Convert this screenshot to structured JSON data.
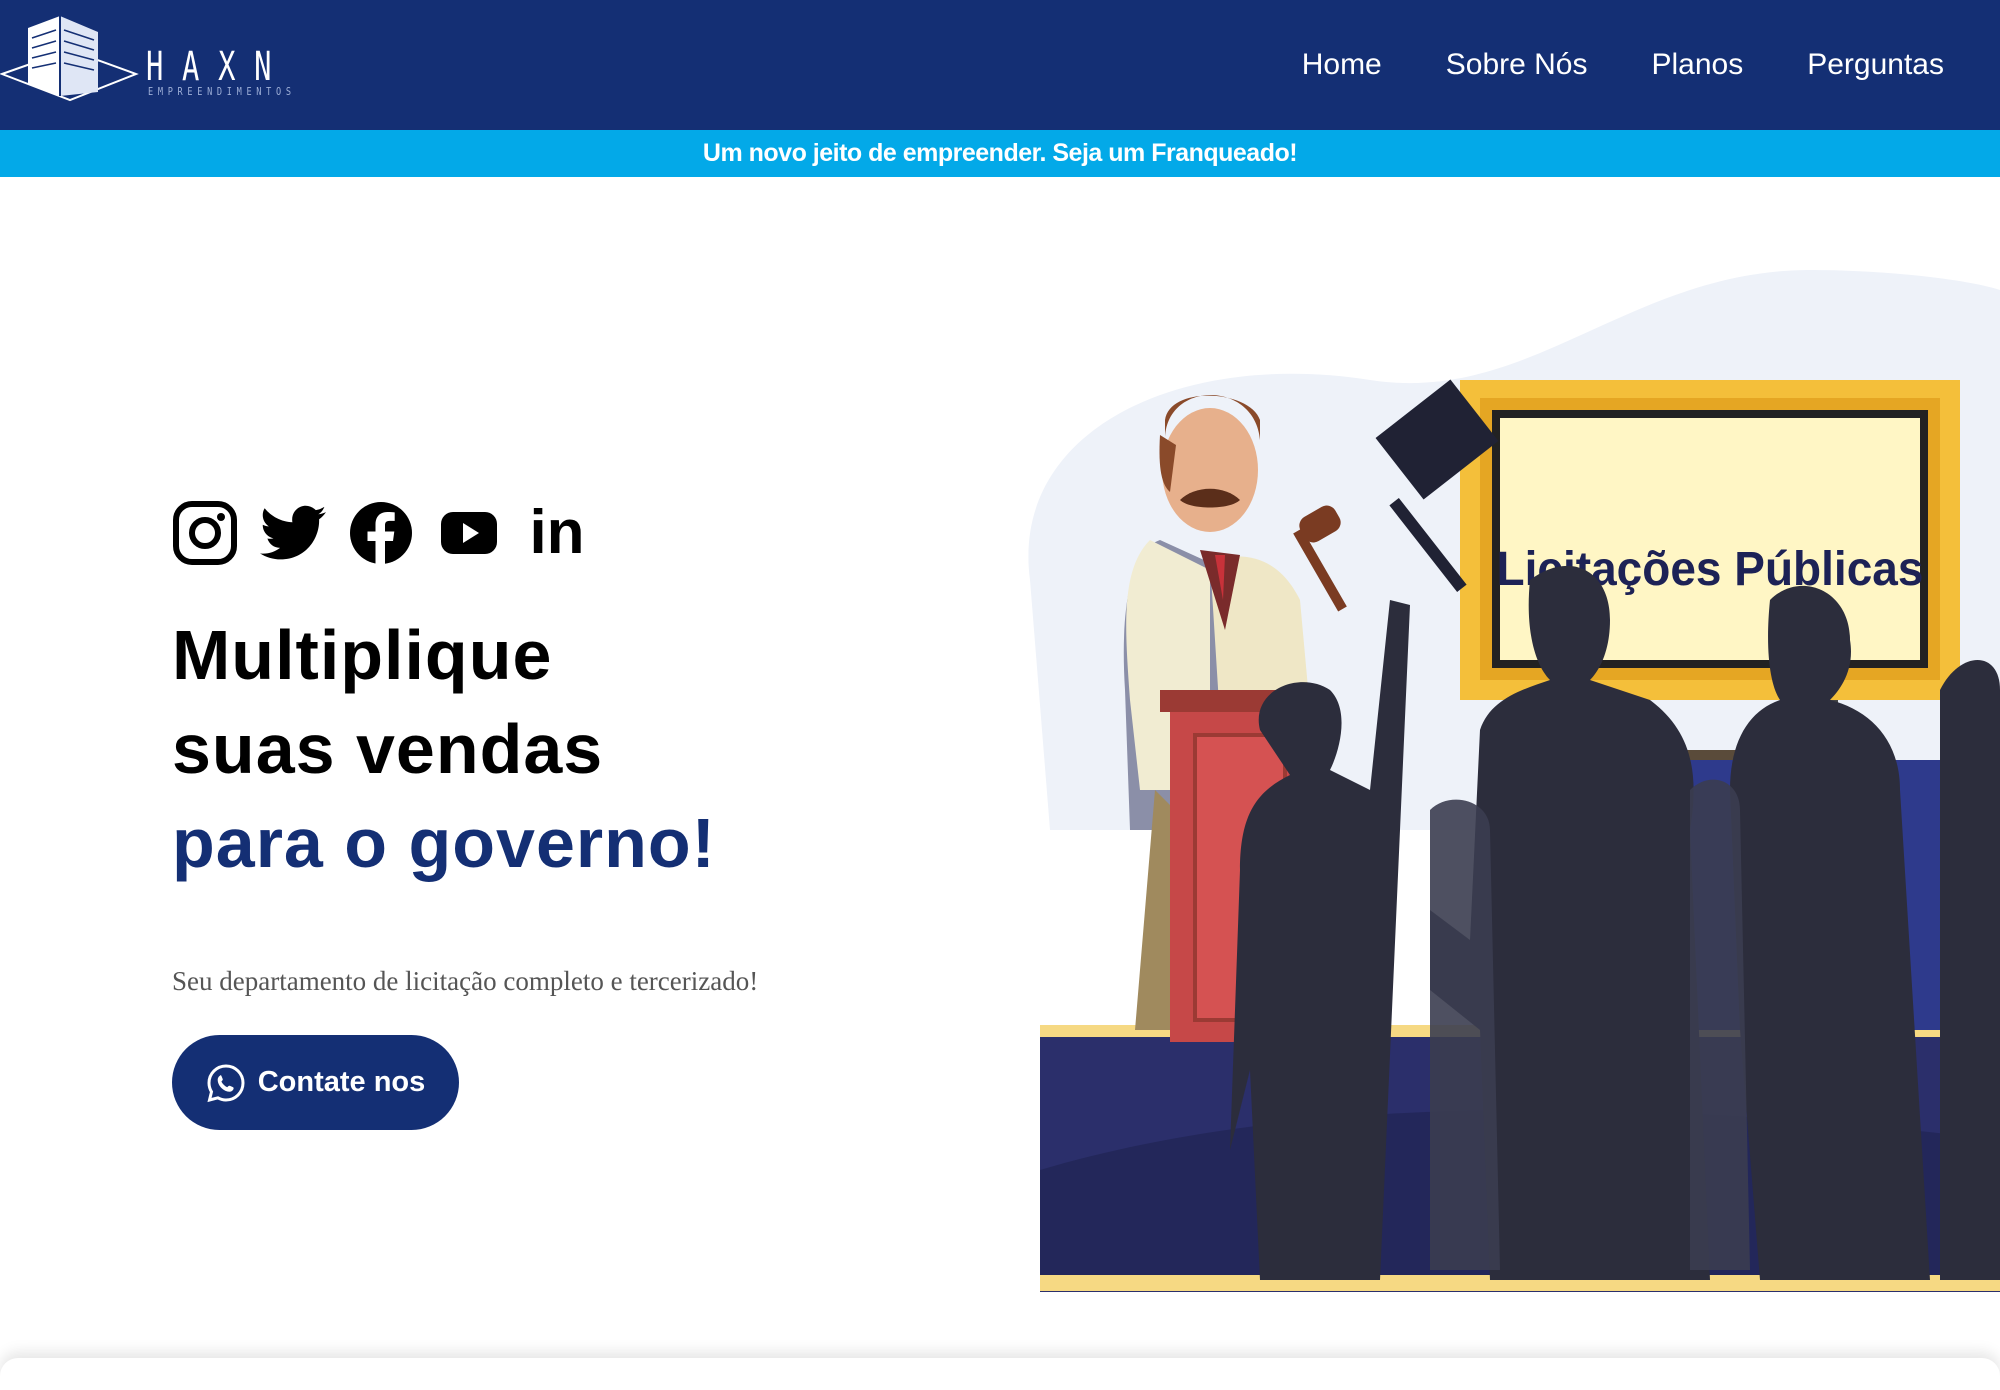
{
  "header": {
    "logo": {
      "word": "HAXN",
      "sub": "EMPREENDIMENTOS"
    },
    "nav": [
      {
        "label": "Home"
      },
      {
        "label": "Sobre Nós"
      },
      {
        "label": "Planos"
      },
      {
        "label": "Perguntas"
      }
    ]
  },
  "banner": {
    "text": "Um novo jeito de empreender. Seja um Franqueado!"
  },
  "hero": {
    "social_icons": [
      "instagram-icon",
      "twitter-icon",
      "facebook-icon",
      "youtube-icon",
      "linkedin-icon"
    ],
    "linkedin_text": "in",
    "headline_line1": "Multiplique",
    "headline_line2": "suas vendas",
    "headline_line3": "para o governo!",
    "subtitle": "Seu departamento de licitação completo e tercerizado!",
    "cta_label": "Contate nos"
  },
  "illustration": {
    "board_text": "Licitações Públicas"
  },
  "colors": {
    "header_bg": "#142f74",
    "banner_bg": "#03a9e8",
    "accent": "#142f74"
  }
}
